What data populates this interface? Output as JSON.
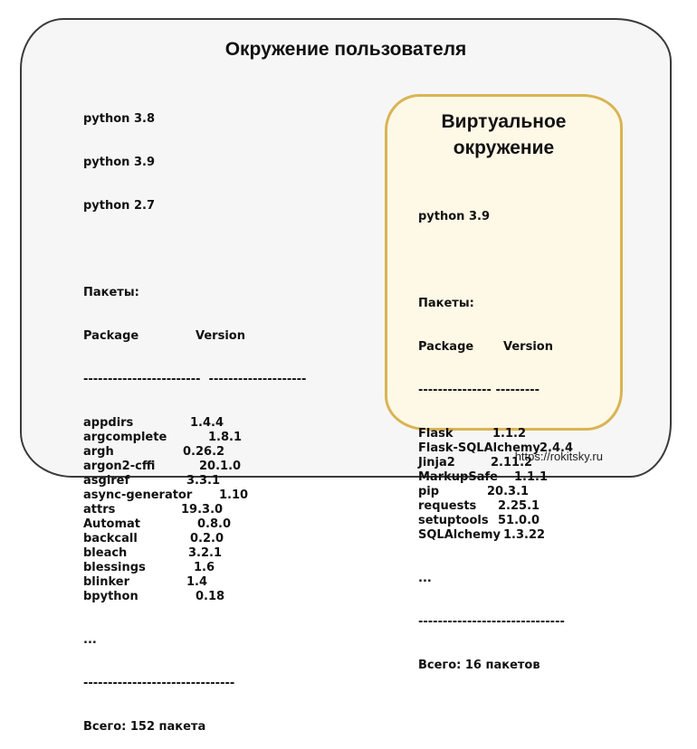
{
  "user_env": {
    "title": "Окружение пользователя",
    "pythons": [
      "python 3.8",
      "python 3.9",
      "python 2.7"
    ],
    "packages_heading": "Пакеты:",
    "col_package": "Package",
    "col_version": "Version",
    "separator": "------------------------  --------------------",
    "packages": [
      {
        "name": "appdirs",
        "version": "1.4.4"
      },
      {
        "name": "argcomplete",
        "version": "1.8.1"
      },
      {
        "name": "argh",
        "version": "0.26.2"
      },
      {
        "name": "argon2-cffi",
        "version": "20.1.0"
      },
      {
        "name": "asgiref",
        "version": "3.3.1"
      },
      {
        "name": "async-generator",
        "version": "1.10"
      },
      {
        "name": "attrs",
        "version": "19.3.0"
      },
      {
        "name": "Automat",
        "version": "0.8.0"
      },
      {
        "name": "backcall",
        "version": "0.2.0"
      },
      {
        "name": "bleach",
        "version": "3.2.1"
      },
      {
        "name": "blessings",
        "version": "1.6"
      },
      {
        "name": "blinker",
        "version": "1.4"
      },
      {
        "name": "bpython",
        "version": "0.18"
      }
    ],
    "ellipsis": "...",
    "bottom_separator": "-------------------------------",
    "total": "Всего: 152 пакета"
  },
  "venv": {
    "title_line1": "Виртуальное",
    "title_line2": "окружение",
    "python": "python 3.9",
    "packages_heading": "Пакеты:",
    "col_package": "Package",
    "col_version": "Version",
    "separator": "--------------- ---------",
    "packages": [
      {
        "name": "Flask",
        "version": "1.1.2"
      },
      {
        "name": "Flask-SQLAlchemy",
        "version": "2.4.4"
      },
      {
        "name": "Jinja2",
        "version": "2.11.2"
      },
      {
        "name": "MarkupSafe",
        "version": "1.1.1"
      },
      {
        "name": "pip",
        "version": "20.3.1"
      },
      {
        "name": "requests",
        "version": "2.25.1"
      },
      {
        "name": "setuptools",
        "version": "51.0.0"
      },
      {
        "name": "SQLAlchemy",
        "version": "1.3.22"
      }
    ],
    "ellipsis": "...",
    "bottom_separator": "------------------------------",
    "total": "Всего: 16 пакетов"
  },
  "footer": {
    "link": "https://rokitsky.ru"
  },
  "colors": {
    "venv_border": "#d9b453",
    "venv_fill": "#fef8e6",
    "outer_fill": "#f6f6f6"
  }
}
